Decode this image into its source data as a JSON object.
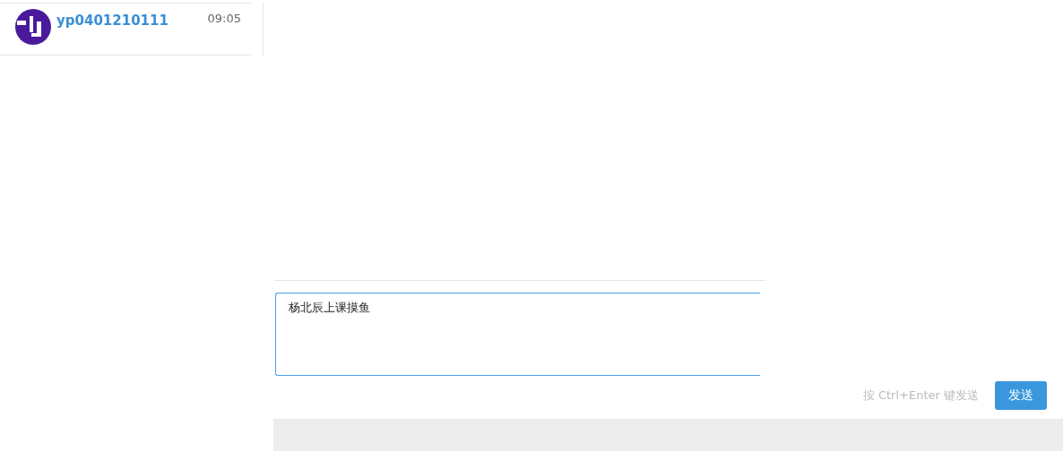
{
  "conversations": [
    {
      "name": "yp0401210111",
      "time": "09:05",
      "selected": false
    }
  ],
  "composer": {
    "value": "杨北辰上课摸鱼",
    "hint": "按 Ctrl+Enter 键发送",
    "send_button": "发送"
  }
}
